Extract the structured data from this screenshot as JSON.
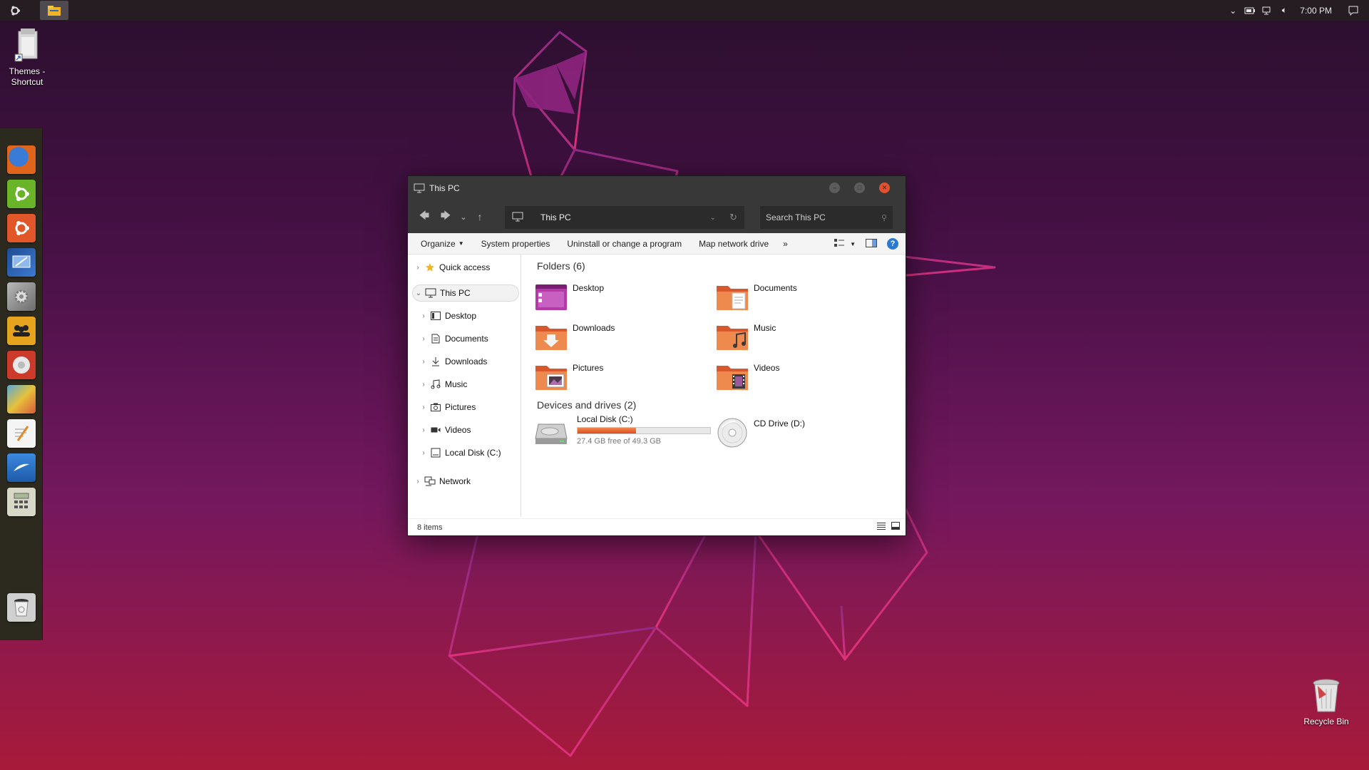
{
  "desktop": {
    "themes_shortcut": "Themes - Shortcut",
    "recycle_bin": "Recycle Bin"
  },
  "taskbar": {
    "start_icon": "ubuntu-logo-icon",
    "file_explorer_icon": "file-explorer-icon",
    "clock": "7:00 PM",
    "tray_icons": [
      "chevron-up-icon",
      "battery-icon",
      "network-icon",
      "volume-icon",
      "notification-icon"
    ]
  },
  "dock": {
    "items": [
      {
        "name": "firefox",
        "color": "#e0641a"
      },
      {
        "name": "ubuntu-software",
        "color": "#6ab42a"
      },
      {
        "name": "ubuntu",
        "color": "#e2572a"
      },
      {
        "name": "remote-desktop",
        "color": "#2c5ea8"
      },
      {
        "name": "settings",
        "color": "#8c8c8c"
      },
      {
        "name": "people",
        "color": "#e6a41e"
      },
      {
        "name": "chrome",
        "color": "#d8d8d8"
      },
      {
        "name": "paint",
        "color": "#caa03a"
      },
      {
        "name": "text-editor",
        "color": "#f0f0f0"
      },
      {
        "name": "libreoffice-writer",
        "color": "#2f7ad0"
      },
      {
        "name": "calculator",
        "color": "#c8c8b8"
      },
      {
        "name": "trash",
        "color": "#d0d0d0"
      }
    ]
  },
  "window": {
    "title": "This PC",
    "address": "This PC",
    "search_placeholder": "Search This PC",
    "toolbar": {
      "organize": "Organize",
      "system_properties": "System properties",
      "uninstall": "Uninstall or change a program",
      "map_drive": "Map network drive",
      "more": "»"
    },
    "nav": {
      "quick_access": "Quick access",
      "this_pc": "This PC",
      "desktop": "Desktop",
      "documents": "Documents",
      "downloads": "Downloads",
      "music": "Music",
      "pictures": "Pictures",
      "videos": "Videos",
      "local_disk": "Local Disk (C:)",
      "network": "Network"
    },
    "folders_header": "Folders (6)",
    "folders": {
      "desktop": "Desktop",
      "documents": "Documents",
      "downloads": "Downloads",
      "music": "Music",
      "pictures": "Pictures",
      "videos": "Videos"
    },
    "drives_header": "Devices and drives (2)",
    "drives": {
      "local": {
        "name": "Local Disk (C:)",
        "free": "27.4 GB free of 49.3 GB",
        "used_fraction": 0.44
      },
      "cd": {
        "name": "CD Drive (D:)"
      }
    },
    "status": "8 items"
  }
}
